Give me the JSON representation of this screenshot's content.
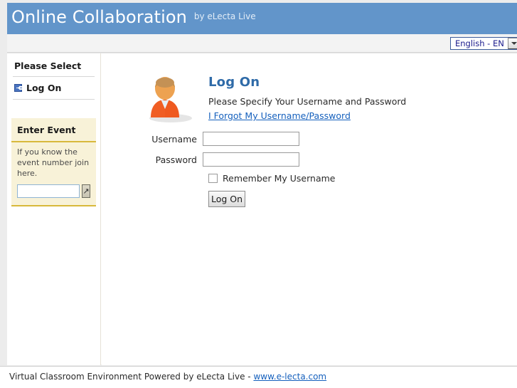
{
  "banner": {
    "title": "Online Collaboration",
    "subtitle": "by eLecta Live",
    "background_color": "#6295ca"
  },
  "language_bar": {
    "selected_language": "English - EN",
    "dropdown_icon": "chevron-down-icon"
  },
  "sidebar": {
    "section_header": "Please Select",
    "nav_items": [
      {
        "label": "Log On",
        "icon": "arrow-right-box-icon"
      }
    ],
    "enter_event": {
      "header": "Enter Event",
      "hint": "If you know the event number join here.",
      "input_value": "",
      "input_placeholder": "",
      "go_button_icon": "arrow-up-right-icon",
      "go_button_glyph": "↗",
      "panel_background": "#f8f2d8",
      "accent_color": "#d8b93c"
    }
  },
  "main": {
    "avatar_icon": "user-avatar-icon",
    "title": "Log On",
    "title_color": "#2f6ba8",
    "subtitle": "Please Specify Your Username and Password",
    "forgot_link": "I Forgot My Username/Password",
    "link_color": "#1560bd",
    "form": {
      "username_label": "Username",
      "username_value": "",
      "username_placeholder": "",
      "password_label": "Password",
      "password_value": "",
      "password_placeholder": "",
      "remember_label": "Remember My Username",
      "remember_checked": false,
      "submit_label": "Log On"
    }
  },
  "footer": {
    "text": "Virtual Classroom Environment Powered by eLecta Live - ",
    "link": "www.e-lecta.com"
  }
}
